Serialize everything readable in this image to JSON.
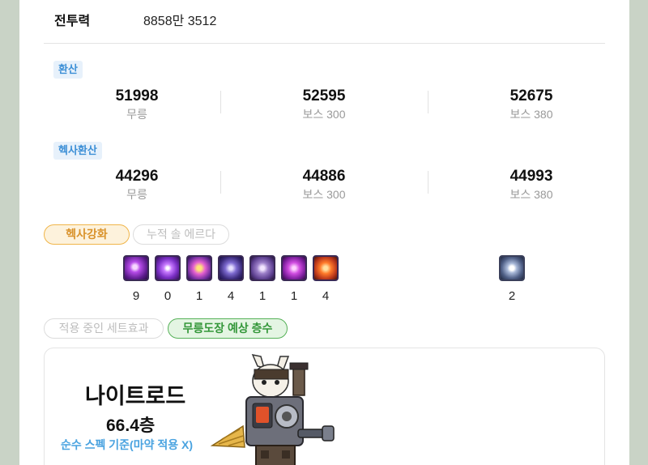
{
  "header": {
    "power_label": "전투력",
    "power_value": "8858만 3512"
  },
  "conversion": {
    "tag": "환산",
    "items": [
      {
        "value": "51998",
        "label": "무릉"
      },
      {
        "value": "52595",
        "label": "보스 300"
      },
      {
        "value": "52675",
        "label": "보스 380"
      }
    ]
  },
  "hexa_conversion": {
    "tag": "헥사환산",
    "items": [
      {
        "value": "44296",
        "label": "무릉"
      },
      {
        "value": "44886",
        "label": "보스 300"
      },
      {
        "value": "44993",
        "label": "보스 380"
      }
    ]
  },
  "tabs_top": {
    "active": "헥사강화",
    "inactive": "누적 솔 에르다"
  },
  "skills": [
    {
      "icon": "hexa-skill-1-icon",
      "level": "9"
    },
    {
      "icon": "hexa-skill-2-icon",
      "level": "0"
    },
    {
      "icon": "hexa-skill-3-icon",
      "level": "1"
    },
    {
      "icon": "hexa-skill-4-icon",
      "level": "4"
    },
    {
      "icon": "hexa-skill-5-icon",
      "level": "1"
    },
    {
      "icon": "hexa-skill-6-icon",
      "level": "1"
    },
    {
      "icon": "hexa-skill-7-icon",
      "level": "4"
    },
    {
      "icon": "hexa-stat-icon",
      "level": "2"
    }
  ],
  "tabs_bottom": {
    "inactive": "적용 중인 세트효과",
    "active": "무릉도장 예상 층수"
  },
  "floor": {
    "job": "나이트로드",
    "floor": "66.4층",
    "note": "순수 스펙 기준(마약 적용 X)"
  },
  "colors": {
    "accent_blue": "#3c8fd6",
    "hexa_orange": "#f0b54a",
    "green": "#56b158",
    "background": "#c9d3c6"
  }
}
